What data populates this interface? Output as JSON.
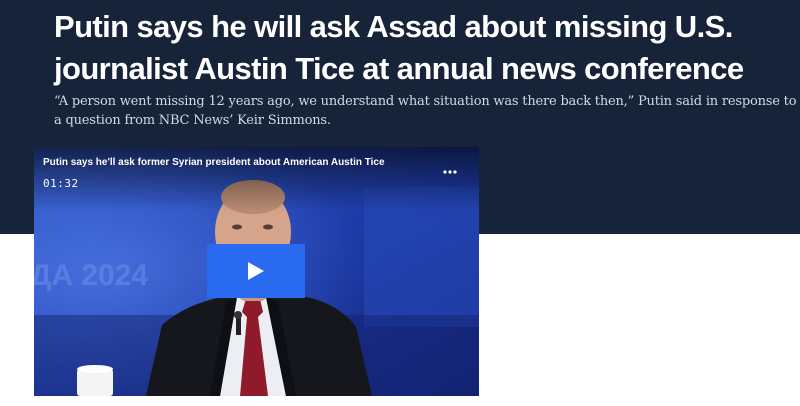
{
  "article": {
    "headline": "Putin says he will ask Assad about missing U.S. journalist Austin Tice at annual news conference",
    "dek": "“A person went missing 12 years ago, we understand what situation was there back then,” Putin said in response to a question from NBC News’ Keir Simmons."
  },
  "video": {
    "title": "Putin says he'll ask former Syrian president about American Austin Tice",
    "duration": "01:32",
    "more_icon": "more-horizontal-icon",
    "play_icon": "play-icon"
  },
  "colors": {
    "hero_background": "#162339",
    "play_button": "#2a6af0",
    "tie": "#8f1a2c"
  }
}
